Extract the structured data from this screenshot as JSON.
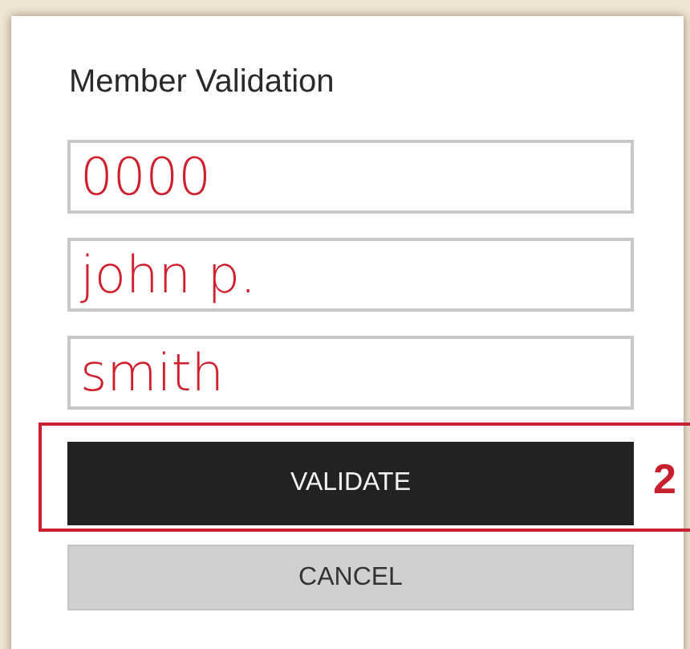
{
  "title": "Member Validation",
  "fields": [
    {
      "value": "0000"
    },
    {
      "value": "john p."
    },
    {
      "value": "smith"
    }
  ],
  "buttons": [
    {
      "label": "VALIDATE",
      "kind": "primary"
    },
    {
      "label": "CANCEL",
      "kind": "secondary"
    }
  ],
  "callout": {
    "label": "2"
  }
}
